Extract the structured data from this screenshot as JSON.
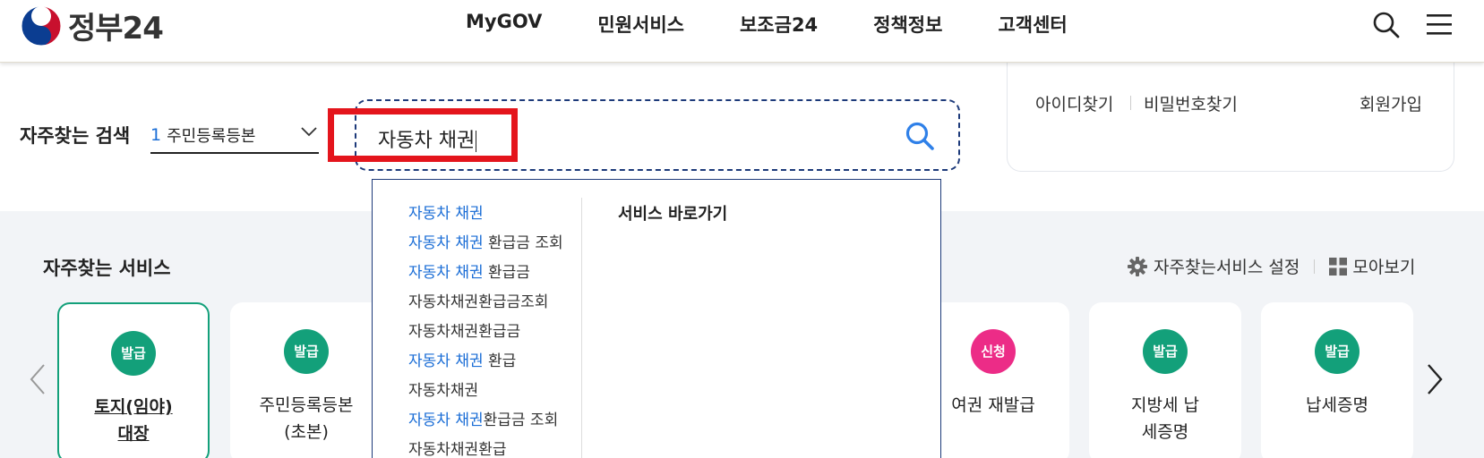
{
  "header": {
    "logo_text": "정부24",
    "nav": [
      "MyGOV",
      "민원서비스",
      "보조금24",
      "정책정보",
      "고객센터"
    ],
    "icons": {
      "search": "search-icon",
      "menu": "hamburger-menu-icon"
    }
  },
  "fav_search": {
    "label": "자주찾는 검색",
    "selected_rank": "1",
    "selected_value": "주민등록등본"
  },
  "search": {
    "value": "자동차 채권"
  },
  "login": {
    "find_id": "아이디찾기",
    "find_pw": "비밀번호찾기",
    "signup": "회원가입"
  },
  "autocomplete": {
    "suggestions": [
      {
        "hl": "자동차 채권",
        "rest": ""
      },
      {
        "hl": "자동차 채권",
        "rest": " 환급금 조회"
      },
      {
        "hl": "자동차 채권",
        "rest": " 환급금"
      },
      {
        "hl": "",
        "rest": "자동차채권환급금조회"
      },
      {
        "hl": "",
        "rest": "자동차채권환급금"
      },
      {
        "hl": "자동차 채권",
        "rest": " 환급"
      },
      {
        "hl": "",
        "rest": "자동차채권"
      },
      {
        "hl": "자동차 채권",
        "rest": "환급금 조회"
      },
      {
        "hl": "",
        "rest": "자동차채권환급"
      }
    ],
    "quick_title": "서비스 바로가기"
  },
  "services": {
    "title": "자주찾는 서비스",
    "settings_label": "자주찾는서비스 설정",
    "view_all_label": "모아보기",
    "cards": [
      {
        "badge": "발급",
        "name": "토지(임야) 대장",
        "color": "#13a07a"
      },
      {
        "badge": "발급",
        "name": "주민등록등본 (초본)",
        "color": "#13a07a"
      },
      {
        "badge": "신청",
        "name": "여권 재발급",
        "color": "#ec2c87"
      },
      {
        "badge": "발급",
        "name": "지방세 납세증명",
        "color": "#13a07a"
      },
      {
        "badge": "발급",
        "name": "납세증명",
        "color": "#13a07a"
      }
    ]
  },
  "colors": {
    "accent": "#1a6dd6",
    "issue_badge": "#13a07a",
    "apply_badge": "#ec2c87",
    "highlight_box": "#e4151c"
  }
}
